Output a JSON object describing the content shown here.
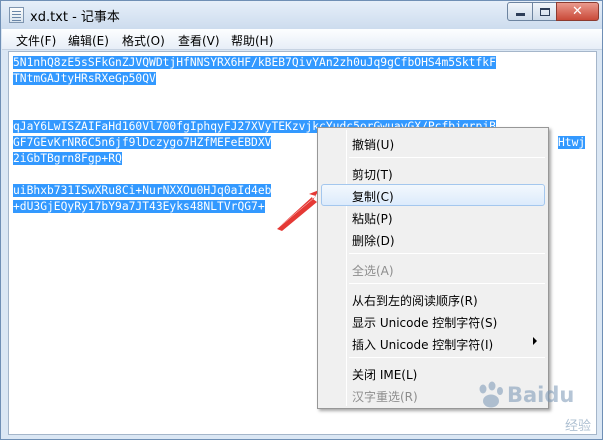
{
  "window": {
    "title": "xd.txt - 记事本"
  },
  "menubar": {
    "items": [
      "文件(F)",
      "编辑(E)",
      "格式(O)",
      "查看(V)",
      "帮助(H)"
    ]
  },
  "editor": {
    "lines": [
      "5N1nhQ8zE5sSFkGnZJVQWDtjHfNNSYRX6HF/kBEB7QivYAn2zh0uJq9gCfbOHS4m5SktfkF",
      "TNtmGAJtyHRsRXeGp50QV",
      "",
      "",
      "qJaY6LwISZAIFaHd160Vl700fgIphqyFJ27XVyTEKzvjkcYudc5orGwuayGX/PcfbiqrpjB",
      "GF7GEvKrNR6C5n6jf9lDczygo7HZfMEFeEBDXV",
      "2iGbTBgrn8Fgp+RQ",
      "",
      "uiBhxb731ISwXRu8Ci+NurNXXOu0HJq0aId4eb",
      "+dU3GjEQyRy17bY9a7JT43Eyks48NLTVrQG7+"
    ],
    "partial_right": "Htwj"
  },
  "context_menu": {
    "items": [
      {
        "label": "撤销(U)",
        "disabled": false
      },
      {
        "label": "剪切(T)",
        "disabled": false
      },
      {
        "label": "复制(C)",
        "disabled": false,
        "highlighted": true
      },
      {
        "label": "粘贴(P)",
        "disabled": false
      },
      {
        "label": "删除(D)",
        "disabled": false
      },
      {
        "label": "全选(A)",
        "disabled": true
      },
      {
        "label": "从右到左的阅读顺序(R)",
        "disabled": false
      },
      {
        "label": "显示 Unicode 控制字符(S)",
        "disabled": false
      },
      {
        "label": "插入 Unicode 控制字符(I)",
        "disabled": false,
        "submenu": true
      },
      {
        "label": "关闭 IME(L)",
        "disabled": false
      },
      {
        "label": "汉字重选(R)",
        "disabled": true
      }
    ]
  },
  "watermark": {
    "text": "Baidu",
    "sub": "经验"
  },
  "colors": {
    "selection": "#3399ff",
    "annotation_arrow": "#e53935"
  }
}
